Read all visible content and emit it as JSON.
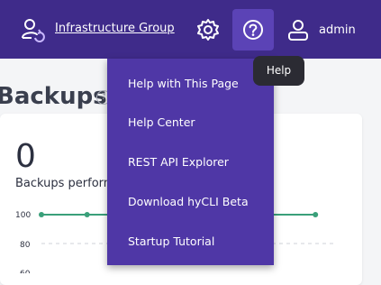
{
  "header": {
    "group_label": "Infrastructure Group",
    "user_label": "admin"
  },
  "page": {
    "title": "Backups",
    "info_glyph": "?"
  },
  "stats": {
    "count": "0",
    "label": "Backups performed"
  },
  "chart_data": {
    "type": "line",
    "ytick_labels": [
      "100",
      "80",
      "60"
    ],
    "series": [
      {
        "values": [
          100,
          100,
          100,
          100,
          100,
          100,
          100
        ]
      }
    ]
  },
  "help_menu": {
    "items": [
      "Help with This Page",
      "Help Center",
      "REST API Explorer",
      "Download hyCLI Beta",
      "Startup Tutorial"
    ]
  },
  "tooltip": {
    "text": "Help"
  },
  "icons": {
    "group": "group-switch-icon",
    "settings": "gear-icon",
    "help": "help-icon",
    "user": "user-icon"
  },
  "colors": {
    "topbar": "#3f2b8a",
    "menu_bg": "#4f37a6",
    "help_button_active": "#5b43b6",
    "series_line": "#3aa07a",
    "tooltip_bg": "#2b2b33"
  }
}
